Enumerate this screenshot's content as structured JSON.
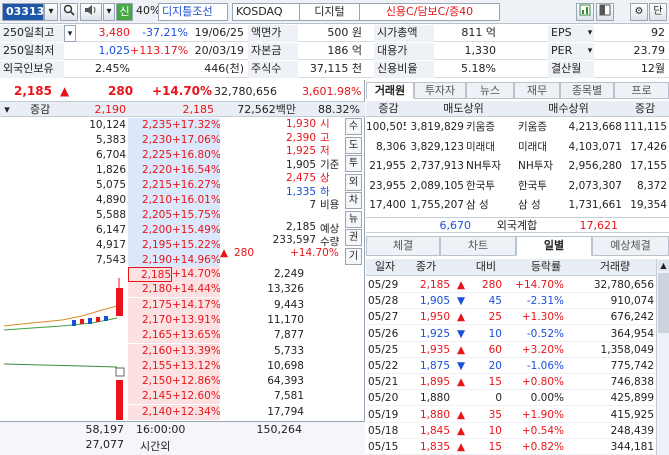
{
  "toolbar": {
    "code": "033130",
    "credit": "신",
    "margin": "40%",
    "name": "디지틀조선",
    "market": "KOSDAQ",
    "sector": "디지털",
    "tags": "신용C/담보C/증40",
    "menu_label": "단"
  },
  "info": {
    "rows": [
      {
        "l1": "250일최고",
        "v1": "3,480",
        "p1": "-37.21%",
        "d1": "19/06/25",
        "l2": "액면가",
        "v2": "500 원",
        "l3": "시가총액",
        "v3": "811 억",
        "l4": "EPS",
        "v4": "92"
      },
      {
        "l1": "250일최저",
        "v1": "1,025",
        "p1": "+113.17%",
        "d1": "20/03/19",
        "l2": "자본금",
        "v2": "186 억",
        "l3": "대용가",
        "v3": "1,330",
        "l4": "PER",
        "v4": "23.79"
      },
      {
        "l1": "외국인보유",
        "v1": "2.45%",
        "p1": "",
        "d1": "446(천)",
        "l2": "주식수",
        "v2": "37,115 천",
        "l3": "신용비율",
        "v3": "5.18%",
        "l4": "결산월",
        "v4": "12월"
      }
    ]
  },
  "price_bar": {
    "price": "2,185",
    "arrow": "▲",
    "change": "280",
    "pct": "+14.70%",
    "volume": "32,780,656",
    "turnover": "3,601.98%"
  },
  "ob_header": {
    "col1": "증감",
    "val1": "2,190",
    "val2": "2,185",
    "amount": "72,562백만",
    "ratio": "88.32%"
  },
  "asks": [
    {
      "qty": "10,124",
      "price": "2,235",
      "pct": "+17.32%"
    },
    {
      "qty": "5,383",
      "price": "2,230",
      "pct": "+17.06%"
    },
    {
      "qty": "6,704",
      "price": "2,225",
      "pct": "+16.80%"
    },
    {
      "qty": "1,826",
      "price": "2,220",
      "pct": "+16.54%"
    },
    {
      "qty": "5,075",
      "price": "2,215",
      "pct": "+16.27%"
    },
    {
      "qty": "4,890",
      "price": "2,210",
      "pct": "+16.01%"
    },
    {
      "qty": "5,588",
      "price": "2,205",
      "pct": "+15.75%"
    },
    {
      "qty": "6,147",
      "price": "2,200",
      "pct": "+15.49%"
    },
    {
      "qty": "4,917",
      "price": "2,195",
      "pct": "+15.22%"
    },
    {
      "qty": "7,543",
      "price": "2,190",
      "pct": "+14.96%"
    }
  ],
  "bids": [
    {
      "price": "2,185",
      "pct": "+14.70%",
      "qty": "2,249"
    },
    {
      "price": "2,180",
      "pct": "+14.44%",
      "qty": "13,326"
    },
    {
      "price": "2,175",
      "pct": "+14.17%",
      "qty": "9,443"
    },
    {
      "price": "2,170",
      "pct": "+13.91%",
      "qty": "11,170"
    },
    {
      "price": "2,165",
      "pct": "+13.65%",
      "qty": "7,877"
    },
    {
      "price": "2,160",
      "pct": "+13.39%",
      "qty": "5,733"
    },
    {
      "price": "2,155",
      "pct": "+13.12%",
      "qty": "10,698"
    },
    {
      "price": "2,150",
      "pct": "+12.86%",
      "qty": "64,393"
    },
    {
      "price": "2,145",
      "pct": "+12.60%",
      "qty": "7,581"
    },
    {
      "price": "2,140",
      "pct": "+12.34%",
      "qty": "17,794"
    }
  ],
  "ohlc": [
    {
      "v": "1,930",
      "l": "시"
    },
    {
      "v": "2,390",
      "l": "고"
    },
    {
      "v": "1,925",
      "l": "저"
    },
    {
      "v": "1,905",
      "l": "기준"
    },
    {
      "v": "2,475",
      "l": "상"
    },
    {
      "v": "1,335",
      "l": "하"
    },
    {
      "v": "7",
      "l": "비용"
    }
  ],
  "expected": {
    "price": "2,185",
    "price_label": "예상",
    "qty": "233,597",
    "qty_label": "수량",
    "arrow": "▲",
    "change": "280",
    "pct": "+14.70%"
  },
  "side_tabs": [
    "수",
    "도",
    "투",
    "외",
    "차",
    "뉴",
    "권",
    "기"
  ],
  "ob_footer": {
    "ask_total": "58,197",
    "bid_total": "150,264",
    "time": "16:00:00",
    "time_label": "시간외",
    "after_qty": "27,077"
  },
  "right_tabs": [
    "거래원",
    "투자자",
    "뉴스",
    "재무",
    "종목별",
    "프로"
  ],
  "broker_header": {
    "c1": "증감",
    "c2": "매도상위",
    "c3": "매수상위",
    "c4": "증감"
  },
  "brokers": [
    {
      "d1": "100,505",
      "q1": "3,819,829",
      "n1": "키움증",
      "n2": "키움증",
      "q2": "4,213,668",
      "d2": "111,115"
    },
    {
      "d1": "8,306",
      "q1": "3,829,123",
      "n1": "미래대",
      "n2": "미래대",
      "q2": "4,103,071",
      "d2": "17,426"
    },
    {
      "d1": "21,955",
      "q1": "2,737,913",
      "n1": "NH투자",
      "n2": "NH투자",
      "q2": "2,956,280",
      "d2": "17,155"
    },
    {
      "d1": "23,955",
      "q1": "2,089,105",
      "n1": "한국투",
      "n2": "한국투",
      "q2": "2,073,307",
      "d2": "8,372"
    },
    {
      "d1": "17,400",
      "q1": "1,755,207",
      "n1": "삼 성",
      "n2": "삼 성",
      "q2": "1,731,661",
      "d2": "19,354"
    }
  ],
  "foreign": {
    "sell": "6,670",
    "label": "외국계합",
    "buy": "17,621"
  },
  "lower_tabs": [
    "체결",
    "차트",
    "일별",
    "예상체결"
  ],
  "daily_header": {
    "date": "일자",
    "close": "종가",
    "change": "대비",
    "rate": "등락률",
    "volume": "거래량"
  },
  "daily": [
    {
      "date": "05/29",
      "close": "2,185",
      "dir": "up",
      "change": "280",
      "rate": "+14.70%",
      "volume": "32,780,656"
    },
    {
      "date": "05/28",
      "close": "1,905",
      "dir": "down",
      "change": "45",
      "rate": "-2.31%",
      "volume": "910,074"
    },
    {
      "date": "05/27",
      "close": "1,950",
      "dir": "up",
      "change": "25",
      "rate": "+1.30%",
      "volume": "676,242"
    },
    {
      "date": "05/26",
      "close": "1,925",
      "dir": "down",
      "change": "10",
      "rate": "-0.52%",
      "volume": "364,954"
    },
    {
      "date": "05/25",
      "close": "1,935",
      "dir": "up",
      "change": "60",
      "rate": "+3.20%",
      "volume": "1,358,049"
    },
    {
      "date": "05/22",
      "close": "1,875",
      "dir": "down",
      "change": "20",
      "rate": "-1.06%",
      "volume": "775,742"
    },
    {
      "date": "05/21",
      "close": "1,895",
      "dir": "up",
      "change": "15",
      "rate": "+0.80%",
      "volume": "746,838"
    },
    {
      "date": "05/20",
      "close": "1,880",
      "dir": "flat",
      "change": "0",
      "rate": "0.00%",
      "volume": "425,899"
    },
    {
      "date": "05/19",
      "close": "1,880",
      "dir": "up",
      "change": "35",
      "rate": "+1.90%",
      "volume": "415,925"
    },
    {
      "date": "05/18",
      "close": "1,845",
      "dir": "up",
      "change": "10",
      "rate": "+0.54%",
      "volume": "248,439"
    },
    {
      "date": "05/15",
      "close": "1,835",
      "dir": "up",
      "change": "15",
      "rate": "+0.82%",
      "volume": "344,181"
    }
  ]
}
